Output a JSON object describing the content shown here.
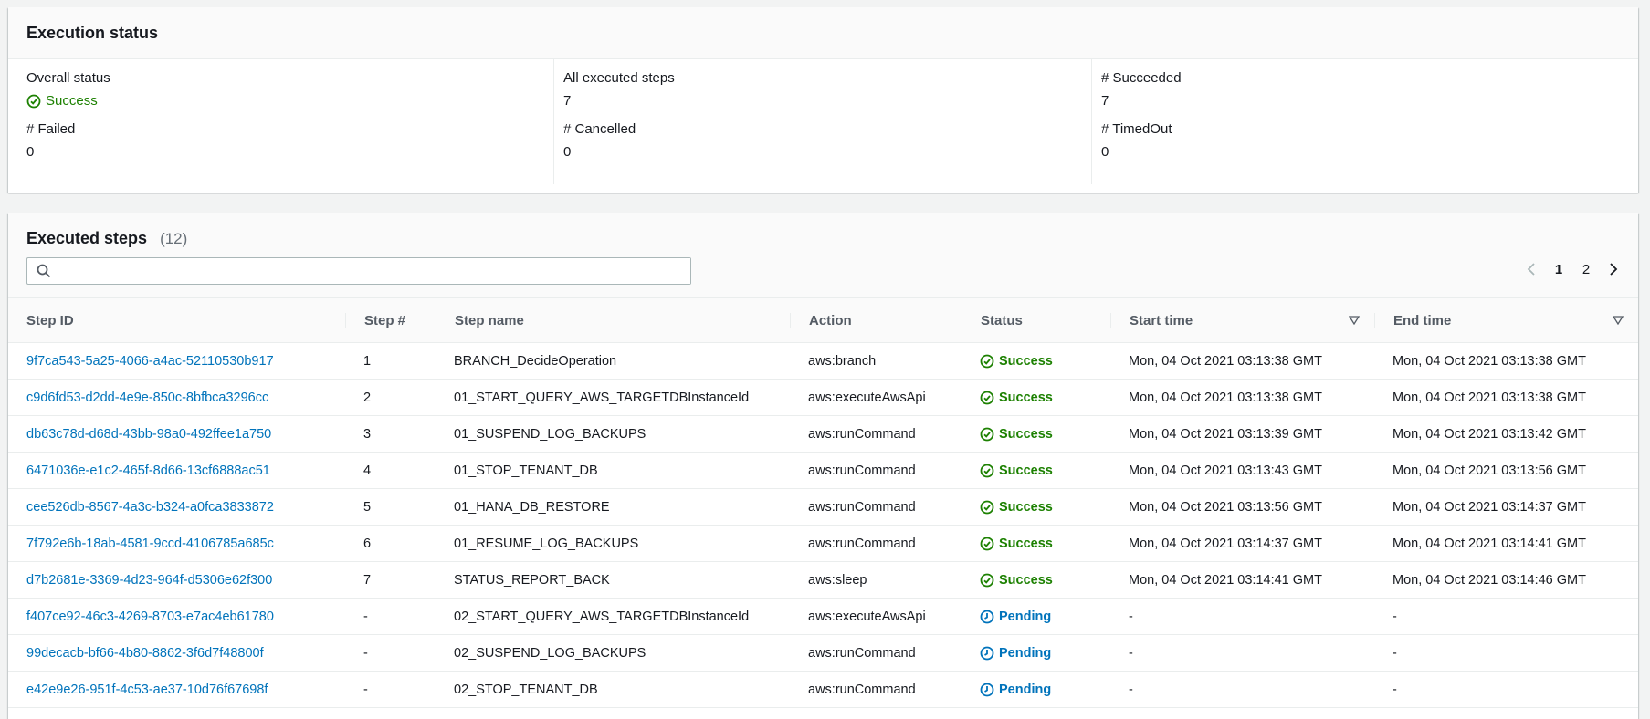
{
  "status_panel": {
    "title": "Execution status",
    "items": [
      {
        "label": "Overall status",
        "value": "Success",
        "icon": "success-icon"
      },
      {
        "label": "All executed steps",
        "value": "7"
      },
      {
        "label": "# Succeeded",
        "value": "7"
      },
      {
        "label": "# Failed",
        "value": "0"
      },
      {
        "label": "# Cancelled",
        "value": "0"
      },
      {
        "label": "# TimedOut",
        "value": "0"
      }
    ]
  },
  "steps_panel": {
    "title": "Executed steps",
    "count": "(12)",
    "search_placeholder": "",
    "pagination": {
      "pages": [
        "1",
        "2"
      ],
      "current": "1"
    },
    "columns": [
      "Step ID",
      "Step #",
      "Step name",
      "Action",
      "Status",
      "Start time",
      "End time"
    ],
    "rows": [
      {
        "id": "9f7ca543-5a25-4066-a4ac-52110530b917",
        "num": "1",
        "name": "BRANCH_DecideOperation",
        "action": "aws:branch",
        "status": "Success",
        "start": "Mon, 04 Oct 2021 03:13:38 GMT",
        "end": "Mon, 04 Oct 2021 03:13:38 GMT"
      },
      {
        "id": "c9d6fd53-d2dd-4e9e-850c-8bfbca3296cc",
        "num": "2",
        "name": "01_START_QUERY_AWS_TARGETDBInstanceId",
        "action": "aws:executeAwsApi",
        "status": "Success",
        "start": "Mon, 04 Oct 2021 03:13:38 GMT",
        "end": "Mon, 04 Oct 2021 03:13:38 GMT"
      },
      {
        "id": "db63c78d-d68d-43bb-98a0-492ffee1a750",
        "num": "3",
        "name": "01_SUSPEND_LOG_BACKUPS",
        "action": "aws:runCommand",
        "status": "Success",
        "start": "Mon, 04 Oct 2021 03:13:39 GMT",
        "end": "Mon, 04 Oct 2021 03:13:42 GMT"
      },
      {
        "id": "6471036e-e1c2-465f-8d66-13cf6888ac51",
        "num": "4",
        "name": "01_STOP_TENANT_DB",
        "action": "aws:runCommand",
        "status": "Success",
        "start": "Mon, 04 Oct 2021 03:13:43 GMT",
        "end": "Mon, 04 Oct 2021 03:13:56 GMT"
      },
      {
        "id": "cee526db-8567-4a3c-b324-a0fca3833872",
        "num": "5",
        "name": "01_HANA_DB_RESTORE",
        "action": "aws:runCommand",
        "status": "Success",
        "start": "Mon, 04 Oct 2021 03:13:56 GMT",
        "end": "Mon, 04 Oct 2021 03:14:37 GMT"
      },
      {
        "id": "7f792e6b-18ab-4581-9ccd-4106785a685c",
        "num": "6",
        "name": "01_RESUME_LOG_BACKUPS",
        "action": "aws:runCommand",
        "status": "Success",
        "start": "Mon, 04 Oct 2021 03:14:37 GMT",
        "end": "Mon, 04 Oct 2021 03:14:41 GMT"
      },
      {
        "id": "d7b2681e-3369-4d23-964f-d5306e62f300",
        "num": "7",
        "name": "STATUS_REPORT_BACK",
        "action": "aws:sleep",
        "status": "Success",
        "start": "Mon, 04 Oct 2021 03:14:41 GMT",
        "end": "Mon, 04 Oct 2021 03:14:46 GMT"
      },
      {
        "id": "f407ce92-46c3-4269-8703-e7ac4eb61780",
        "num": "-",
        "name": "02_START_QUERY_AWS_TARGETDBInstanceId",
        "action": "aws:executeAwsApi",
        "status": "Pending",
        "start": "-",
        "end": "-"
      },
      {
        "id": "99decacb-bf66-4b80-8862-3f6d7f48800f",
        "num": "-",
        "name": "02_SUSPEND_LOG_BACKUPS",
        "action": "aws:runCommand",
        "status": "Pending",
        "start": "-",
        "end": "-"
      },
      {
        "id": "e42e9e26-951f-4c53-ae37-10d76f67698f",
        "num": "-",
        "name": "02_STOP_TENANT_DB",
        "action": "aws:runCommand",
        "status": "Pending",
        "start": "-",
        "end": "-"
      }
    ]
  },
  "colors": {
    "success": "#1d8102",
    "pending": "#0073bb",
    "link": "#0073bb"
  }
}
